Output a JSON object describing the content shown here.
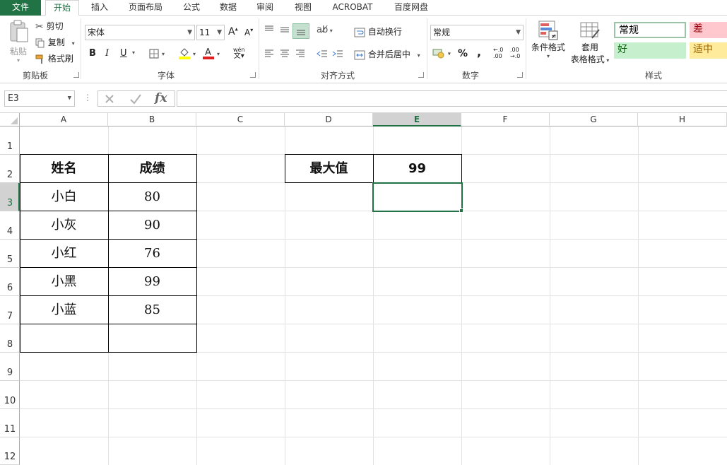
{
  "tabs": {
    "file": "文件",
    "home": "开始",
    "insert": "插入",
    "layout": "页面布局",
    "formulas": "公式",
    "data": "数据",
    "review": "审阅",
    "view": "视图",
    "acrobat": "ACROBAT",
    "baidu": "百度网盘"
  },
  "clipboard": {
    "paste": "粘贴",
    "cut": "剪切",
    "copy": "复制",
    "painter": "格式刷",
    "label": "剪贴板"
  },
  "font": {
    "name": "宋体",
    "size": "11",
    "bold": "B",
    "italic": "I",
    "underline": "U",
    "label": "字体",
    "phonetic": "wén"
  },
  "alignment": {
    "wrap": "自动换行",
    "merge": "合并后居中",
    "label": "对齐方式"
  },
  "number": {
    "format": "常规",
    "percent": "%",
    "comma": ",",
    "label": "数字"
  },
  "styles_group": {
    "conditional": "条件格式",
    "table_format_1": "套用",
    "table_format_2": "表格格式",
    "normal": "常规",
    "bad": "差",
    "good": "好",
    "neutral": "适中",
    "label": "样式"
  },
  "formula_bar": {
    "name_box": "E3",
    "fx": "fx",
    "value": ""
  },
  "columns": [
    "A",
    "B",
    "C",
    "D",
    "E",
    "F",
    "G",
    "H"
  ],
  "rows": [
    "1",
    "2",
    "3",
    "4",
    "5",
    "6",
    "7",
    "8",
    "9",
    "10",
    "11",
    "12"
  ],
  "table": {
    "header_name": "姓名",
    "header_score": "成绩",
    "records": [
      {
        "name": "小白",
        "score": "80"
      },
      {
        "name": "小灰",
        "score": "90"
      },
      {
        "name": "小红",
        "score": "76"
      },
      {
        "name": "小黑",
        "score": "99"
      },
      {
        "name": "小蓝",
        "score": "85"
      }
    ]
  },
  "max_box": {
    "label": "最大值",
    "value": "99"
  },
  "selected_cell": "E3",
  "colors": {
    "accent": "#217346",
    "bad_bg": "#ffc7ce",
    "bad_text": "#9c0006",
    "good_bg": "#c6efce",
    "good_text": "#006100",
    "neutral_bg": "#ffeb9c",
    "neutral_text": "#9c6500"
  }
}
